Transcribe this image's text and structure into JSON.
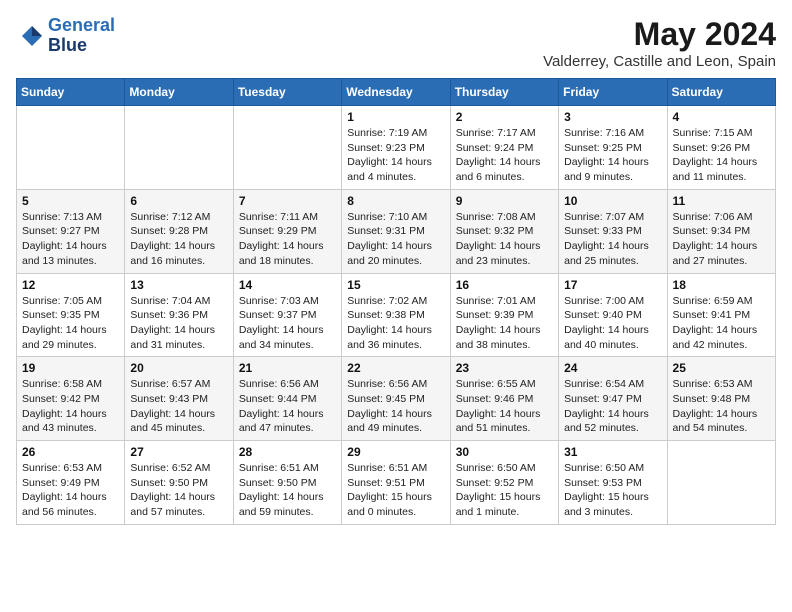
{
  "logo": {
    "line1": "General",
    "line2": "Blue"
  },
  "title": "May 2024",
  "subtitle": "Valderrey, Castille and Leon, Spain",
  "weekdays": [
    "Sunday",
    "Monday",
    "Tuesday",
    "Wednesday",
    "Thursday",
    "Friday",
    "Saturday"
  ],
  "weeks": [
    [
      {
        "day": "",
        "detail": ""
      },
      {
        "day": "",
        "detail": ""
      },
      {
        "day": "",
        "detail": ""
      },
      {
        "day": "1",
        "detail": "Sunrise: 7:19 AM\nSunset: 9:23 PM\nDaylight: 14 hours\nand 4 minutes."
      },
      {
        "day": "2",
        "detail": "Sunrise: 7:17 AM\nSunset: 9:24 PM\nDaylight: 14 hours\nand 6 minutes."
      },
      {
        "day": "3",
        "detail": "Sunrise: 7:16 AM\nSunset: 9:25 PM\nDaylight: 14 hours\nand 9 minutes."
      },
      {
        "day": "4",
        "detail": "Sunrise: 7:15 AM\nSunset: 9:26 PM\nDaylight: 14 hours\nand 11 minutes."
      }
    ],
    [
      {
        "day": "5",
        "detail": "Sunrise: 7:13 AM\nSunset: 9:27 PM\nDaylight: 14 hours\nand 13 minutes."
      },
      {
        "day": "6",
        "detail": "Sunrise: 7:12 AM\nSunset: 9:28 PM\nDaylight: 14 hours\nand 16 minutes."
      },
      {
        "day": "7",
        "detail": "Sunrise: 7:11 AM\nSunset: 9:29 PM\nDaylight: 14 hours\nand 18 minutes."
      },
      {
        "day": "8",
        "detail": "Sunrise: 7:10 AM\nSunset: 9:31 PM\nDaylight: 14 hours\nand 20 minutes."
      },
      {
        "day": "9",
        "detail": "Sunrise: 7:08 AM\nSunset: 9:32 PM\nDaylight: 14 hours\nand 23 minutes."
      },
      {
        "day": "10",
        "detail": "Sunrise: 7:07 AM\nSunset: 9:33 PM\nDaylight: 14 hours\nand 25 minutes."
      },
      {
        "day": "11",
        "detail": "Sunrise: 7:06 AM\nSunset: 9:34 PM\nDaylight: 14 hours\nand 27 minutes."
      }
    ],
    [
      {
        "day": "12",
        "detail": "Sunrise: 7:05 AM\nSunset: 9:35 PM\nDaylight: 14 hours\nand 29 minutes."
      },
      {
        "day": "13",
        "detail": "Sunrise: 7:04 AM\nSunset: 9:36 PM\nDaylight: 14 hours\nand 31 minutes."
      },
      {
        "day": "14",
        "detail": "Sunrise: 7:03 AM\nSunset: 9:37 PM\nDaylight: 14 hours\nand 34 minutes."
      },
      {
        "day": "15",
        "detail": "Sunrise: 7:02 AM\nSunset: 9:38 PM\nDaylight: 14 hours\nand 36 minutes."
      },
      {
        "day": "16",
        "detail": "Sunrise: 7:01 AM\nSunset: 9:39 PM\nDaylight: 14 hours\nand 38 minutes."
      },
      {
        "day": "17",
        "detail": "Sunrise: 7:00 AM\nSunset: 9:40 PM\nDaylight: 14 hours\nand 40 minutes."
      },
      {
        "day": "18",
        "detail": "Sunrise: 6:59 AM\nSunset: 9:41 PM\nDaylight: 14 hours\nand 42 minutes."
      }
    ],
    [
      {
        "day": "19",
        "detail": "Sunrise: 6:58 AM\nSunset: 9:42 PM\nDaylight: 14 hours\nand 43 minutes."
      },
      {
        "day": "20",
        "detail": "Sunrise: 6:57 AM\nSunset: 9:43 PM\nDaylight: 14 hours\nand 45 minutes."
      },
      {
        "day": "21",
        "detail": "Sunrise: 6:56 AM\nSunset: 9:44 PM\nDaylight: 14 hours\nand 47 minutes."
      },
      {
        "day": "22",
        "detail": "Sunrise: 6:56 AM\nSunset: 9:45 PM\nDaylight: 14 hours\nand 49 minutes."
      },
      {
        "day": "23",
        "detail": "Sunrise: 6:55 AM\nSunset: 9:46 PM\nDaylight: 14 hours\nand 51 minutes."
      },
      {
        "day": "24",
        "detail": "Sunrise: 6:54 AM\nSunset: 9:47 PM\nDaylight: 14 hours\nand 52 minutes."
      },
      {
        "day": "25",
        "detail": "Sunrise: 6:53 AM\nSunset: 9:48 PM\nDaylight: 14 hours\nand 54 minutes."
      }
    ],
    [
      {
        "day": "26",
        "detail": "Sunrise: 6:53 AM\nSunset: 9:49 PM\nDaylight: 14 hours\nand 56 minutes."
      },
      {
        "day": "27",
        "detail": "Sunrise: 6:52 AM\nSunset: 9:50 PM\nDaylight: 14 hours\nand 57 minutes."
      },
      {
        "day": "28",
        "detail": "Sunrise: 6:51 AM\nSunset: 9:50 PM\nDaylight: 14 hours\nand 59 minutes."
      },
      {
        "day": "29",
        "detail": "Sunrise: 6:51 AM\nSunset: 9:51 PM\nDaylight: 15 hours\nand 0 minutes."
      },
      {
        "day": "30",
        "detail": "Sunrise: 6:50 AM\nSunset: 9:52 PM\nDaylight: 15 hours\nand 1 minute."
      },
      {
        "day": "31",
        "detail": "Sunrise: 6:50 AM\nSunset: 9:53 PM\nDaylight: 15 hours\nand 3 minutes."
      },
      {
        "day": "",
        "detail": ""
      }
    ]
  ]
}
